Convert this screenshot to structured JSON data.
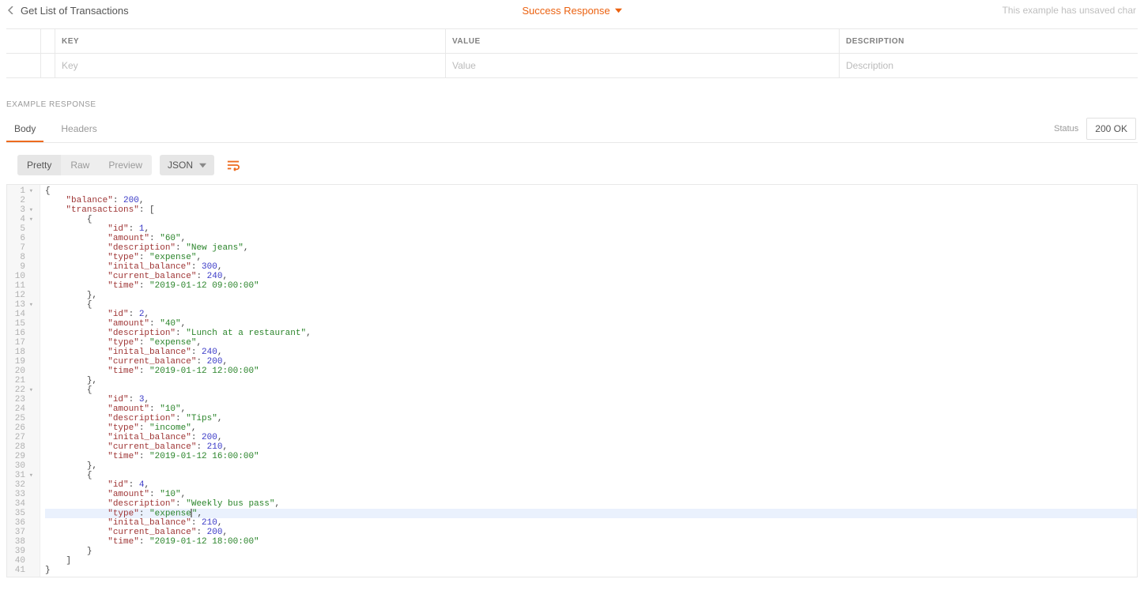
{
  "header": {
    "title": "Get List of Transactions",
    "center_label": "Success Response",
    "unsaved_notice": "This example has unsaved char"
  },
  "kv_table": {
    "headers": {
      "key": "KEY",
      "value": "VALUE",
      "description": "DESCRIPTION"
    },
    "placeholders": {
      "key": "Key",
      "value": "Value",
      "description": "Description"
    }
  },
  "section_label": "EXAMPLE RESPONSE",
  "tabs": {
    "body": "Body",
    "headers": "Headers"
  },
  "status": {
    "label": "Status",
    "value": "200 OK"
  },
  "toolbar": {
    "pretty": "Pretty",
    "raw": "Raw",
    "preview": "Preview",
    "format": "JSON"
  },
  "highlighted_line": 35,
  "code_lines": [
    {
      "n": 1,
      "fold": true,
      "indent": 0,
      "tokens": [
        [
          "punc",
          "{"
        ]
      ]
    },
    {
      "n": 2,
      "indent": 1,
      "tokens": [
        [
          "key",
          "\"balance\""
        ],
        [
          "punc",
          ": "
        ],
        [
          "num",
          "200"
        ],
        [
          "punc",
          ","
        ]
      ]
    },
    {
      "n": 3,
      "fold": true,
      "indent": 1,
      "tokens": [
        [
          "key",
          "\"transactions\""
        ],
        [
          "punc",
          ": ["
        ]
      ]
    },
    {
      "n": 4,
      "fold": true,
      "indent": 2,
      "tokens": [
        [
          "punc",
          "{"
        ]
      ]
    },
    {
      "n": 5,
      "indent": 3,
      "tokens": [
        [
          "key",
          "\"id\""
        ],
        [
          "punc",
          ": "
        ],
        [
          "num",
          "1"
        ],
        [
          "punc",
          ","
        ]
      ]
    },
    {
      "n": 6,
      "indent": 3,
      "tokens": [
        [
          "key",
          "\"amount\""
        ],
        [
          "punc",
          ": "
        ],
        [
          "str",
          "\"60\""
        ],
        [
          "punc",
          ","
        ]
      ]
    },
    {
      "n": 7,
      "indent": 3,
      "tokens": [
        [
          "key",
          "\"description\""
        ],
        [
          "punc",
          ": "
        ],
        [
          "str",
          "\"New jeans\""
        ],
        [
          "punc",
          ","
        ]
      ]
    },
    {
      "n": 8,
      "indent": 3,
      "tokens": [
        [
          "key",
          "\"type\""
        ],
        [
          "punc",
          ": "
        ],
        [
          "str",
          "\"expense\""
        ],
        [
          "punc",
          ","
        ]
      ]
    },
    {
      "n": 9,
      "indent": 3,
      "tokens": [
        [
          "key",
          "\"inital_balance\""
        ],
        [
          "punc",
          ": "
        ],
        [
          "num",
          "300"
        ],
        [
          "punc",
          ","
        ]
      ]
    },
    {
      "n": 10,
      "indent": 3,
      "tokens": [
        [
          "key",
          "\"current_balance\""
        ],
        [
          "punc",
          ": "
        ],
        [
          "num",
          "240"
        ],
        [
          "punc",
          ","
        ]
      ]
    },
    {
      "n": 11,
      "indent": 3,
      "tokens": [
        [
          "key",
          "\"time\""
        ],
        [
          "punc",
          ": "
        ],
        [
          "str",
          "\"2019-01-12 09:00:00\""
        ]
      ]
    },
    {
      "n": 12,
      "indent": 2,
      "tokens": [
        [
          "punc",
          "},"
        ]
      ]
    },
    {
      "n": 13,
      "fold": true,
      "indent": 2,
      "tokens": [
        [
          "punc",
          "{"
        ]
      ]
    },
    {
      "n": 14,
      "indent": 3,
      "tokens": [
        [
          "key",
          "\"id\""
        ],
        [
          "punc",
          ": "
        ],
        [
          "num",
          "2"
        ],
        [
          "punc",
          ","
        ]
      ]
    },
    {
      "n": 15,
      "indent": 3,
      "tokens": [
        [
          "key",
          "\"amount\""
        ],
        [
          "punc",
          ": "
        ],
        [
          "str",
          "\"40\""
        ],
        [
          "punc",
          ","
        ]
      ]
    },
    {
      "n": 16,
      "indent": 3,
      "tokens": [
        [
          "key",
          "\"description\""
        ],
        [
          "punc",
          ": "
        ],
        [
          "str",
          "\"Lunch at a restaurant\""
        ],
        [
          "punc",
          ","
        ]
      ]
    },
    {
      "n": 17,
      "indent": 3,
      "tokens": [
        [
          "key",
          "\"type\""
        ],
        [
          "punc",
          ": "
        ],
        [
          "str",
          "\"expense\""
        ],
        [
          "punc",
          ","
        ]
      ]
    },
    {
      "n": 18,
      "indent": 3,
      "tokens": [
        [
          "key",
          "\"inital_balance\""
        ],
        [
          "punc",
          ": "
        ],
        [
          "num",
          "240"
        ],
        [
          "punc",
          ","
        ]
      ]
    },
    {
      "n": 19,
      "indent": 3,
      "tokens": [
        [
          "key",
          "\"current_balance\""
        ],
        [
          "punc",
          ": "
        ],
        [
          "num",
          "200"
        ],
        [
          "punc",
          ","
        ]
      ]
    },
    {
      "n": 20,
      "indent": 3,
      "tokens": [
        [
          "key",
          "\"time\""
        ],
        [
          "punc",
          ": "
        ],
        [
          "str",
          "\"2019-01-12 12:00:00\""
        ]
      ]
    },
    {
      "n": 21,
      "indent": 2,
      "tokens": [
        [
          "punc",
          "},"
        ]
      ]
    },
    {
      "n": 22,
      "fold": true,
      "indent": 2,
      "tokens": [
        [
          "punc",
          "{"
        ]
      ]
    },
    {
      "n": 23,
      "indent": 3,
      "tokens": [
        [
          "key",
          "\"id\""
        ],
        [
          "punc",
          ": "
        ],
        [
          "num",
          "3"
        ],
        [
          "punc",
          ","
        ]
      ]
    },
    {
      "n": 24,
      "indent": 3,
      "tokens": [
        [
          "key",
          "\"amount\""
        ],
        [
          "punc",
          ": "
        ],
        [
          "str",
          "\"10\""
        ],
        [
          "punc",
          ","
        ]
      ]
    },
    {
      "n": 25,
      "indent": 3,
      "tokens": [
        [
          "key",
          "\"description\""
        ],
        [
          "punc",
          ": "
        ],
        [
          "str",
          "\"Tips\""
        ],
        [
          "punc",
          ","
        ]
      ]
    },
    {
      "n": 26,
      "indent": 3,
      "tokens": [
        [
          "key",
          "\"type\""
        ],
        [
          "punc",
          ": "
        ],
        [
          "str",
          "\"income\""
        ],
        [
          "punc",
          ","
        ]
      ]
    },
    {
      "n": 27,
      "indent": 3,
      "tokens": [
        [
          "key",
          "\"inital_balance\""
        ],
        [
          "punc",
          ": "
        ],
        [
          "num",
          "200"
        ],
        [
          "punc",
          ","
        ]
      ]
    },
    {
      "n": 28,
      "indent": 3,
      "tokens": [
        [
          "key",
          "\"current_balance\""
        ],
        [
          "punc",
          ": "
        ],
        [
          "num",
          "210"
        ],
        [
          "punc",
          ","
        ]
      ]
    },
    {
      "n": 29,
      "indent": 3,
      "tokens": [
        [
          "key",
          "\"time\""
        ],
        [
          "punc",
          ": "
        ],
        [
          "str",
          "\"2019-01-12 16:00:00\""
        ]
      ]
    },
    {
      "n": 30,
      "indent": 2,
      "tokens": [
        [
          "punc",
          "},"
        ]
      ]
    },
    {
      "n": 31,
      "fold": true,
      "indent": 2,
      "tokens": [
        [
          "punc",
          "{"
        ]
      ]
    },
    {
      "n": 32,
      "indent": 3,
      "tokens": [
        [
          "key",
          "\"id\""
        ],
        [
          "punc",
          ": "
        ],
        [
          "num",
          "4"
        ],
        [
          "punc",
          ","
        ]
      ]
    },
    {
      "n": 33,
      "indent": 3,
      "tokens": [
        [
          "key",
          "\"amount\""
        ],
        [
          "punc",
          ": "
        ],
        [
          "str",
          "\"10\""
        ],
        [
          "punc",
          ","
        ]
      ]
    },
    {
      "n": 34,
      "indent": 3,
      "tokens": [
        [
          "key",
          "\"description\""
        ],
        [
          "punc",
          ": "
        ],
        [
          "str",
          "\"Weekly bus pass\""
        ],
        [
          "punc",
          ","
        ]
      ]
    },
    {
      "n": 35,
      "indent": 3,
      "tokens": [
        [
          "key",
          "\"type\""
        ],
        [
          "punc",
          ": "
        ],
        [
          "str",
          "\"expense"
        ],
        [
          "cursor",
          ""
        ],
        [
          "str",
          "\""
        ],
        [
          "punc",
          ","
        ]
      ]
    },
    {
      "n": 36,
      "indent": 3,
      "tokens": [
        [
          "key",
          "\"inital_balance\""
        ],
        [
          "punc",
          ": "
        ],
        [
          "num",
          "210"
        ],
        [
          "punc",
          ","
        ]
      ]
    },
    {
      "n": 37,
      "indent": 3,
      "tokens": [
        [
          "key",
          "\"current_balance\""
        ],
        [
          "punc",
          ": "
        ],
        [
          "num",
          "200"
        ],
        [
          "punc",
          ","
        ]
      ]
    },
    {
      "n": 38,
      "indent": 3,
      "tokens": [
        [
          "key",
          "\"time\""
        ],
        [
          "punc",
          ": "
        ],
        [
          "str",
          "\"2019-01-12 18:00:00\""
        ]
      ]
    },
    {
      "n": 39,
      "indent": 2,
      "tokens": [
        [
          "punc",
          "}"
        ]
      ]
    },
    {
      "n": 40,
      "indent": 1,
      "tokens": [
        [
          "punc",
          "]"
        ]
      ]
    },
    {
      "n": 41,
      "indent": 0,
      "tokens": [
        [
          "punc",
          "}"
        ]
      ]
    }
  ]
}
